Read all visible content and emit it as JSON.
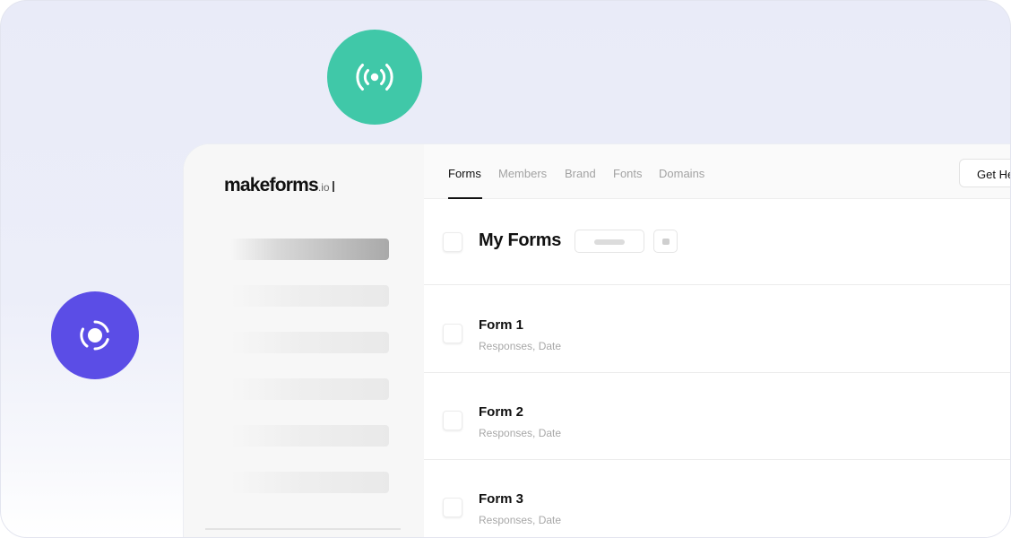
{
  "icons": {
    "green_circle": "broadcast-icon",
    "purple_circle": "live-record-icon"
  },
  "colors": {
    "green_accent": "#40c8a8",
    "purple_accent": "#5b4de6",
    "background": "#eceef9"
  },
  "logo": {
    "name": "makeforms",
    "suffix": ".io"
  },
  "nav": {
    "tabs": [
      {
        "label": "Forms",
        "active": true
      },
      {
        "label": "Members",
        "active": false
      },
      {
        "label": "Brand",
        "active": false
      },
      {
        "label": "Fonts",
        "active": false
      },
      {
        "label": "Domains",
        "active": false
      }
    ],
    "help_button": "Get He"
  },
  "header": {
    "title": "My Forms"
  },
  "forms": [
    {
      "name": "Form 1",
      "meta": "Responses, Date"
    },
    {
      "name": "Form 2",
      "meta": "Responses, Date"
    },
    {
      "name": "Form 3",
      "meta": "Responses, Date"
    }
  ]
}
